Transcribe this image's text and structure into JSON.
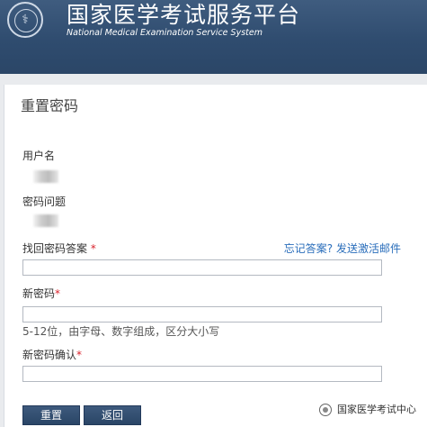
{
  "header": {
    "title": "国家医学考试服务平台",
    "subtitle": "National Medical Examination Service System",
    "logo_icon": "medical-exam-seal"
  },
  "form": {
    "title": "重置密码",
    "username_label": "用户名",
    "question_label": "密码问题",
    "answer_label": "找回密码答案",
    "required_mark": "*",
    "forgot_link": "忘记答案?",
    "activation_link": "发送激活邮件",
    "new_password_label": "新密码",
    "new_password_hint": "5-12位，由字母、数字组成，区分大小写",
    "confirm_label": "新密码确认",
    "answer_value": "",
    "new_password_value": "",
    "confirm_value": ""
  },
  "buttons": {
    "reset": "重置",
    "back": "返回"
  },
  "watermark": {
    "text": "国家医学考试中心"
  },
  "colors": {
    "header_bg": "#2f4c6f",
    "button_bg": "#2f4b6d",
    "link": "#2a6ebb",
    "required": "#d9232d"
  }
}
